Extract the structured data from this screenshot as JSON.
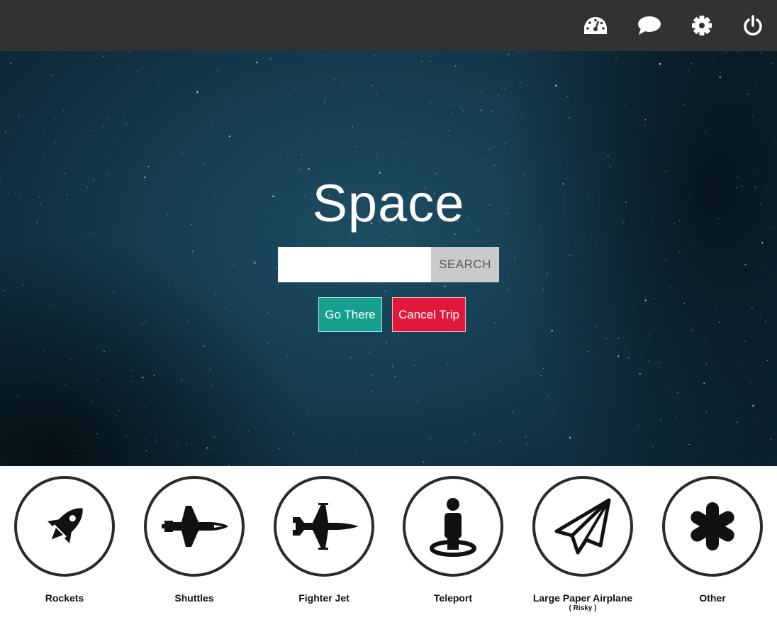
{
  "topbar": {
    "icons": [
      "dashboard-icon",
      "chat-bubble-icon",
      "gear-icon",
      "power-icon"
    ]
  },
  "hero": {
    "title": "Space",
    "search": {
      "value": "",
      "placeholder": "",
      "button_label": "SEARCH"
    },
    "go_label": "Go There",
    "cancel_label": "Cancel Trip"
  },
  "modes": [
    {
      "label": "Rockets",
      "icon": "rocket-icon"
    },
    {
      "label": "Shuttles",
      "icon": "space-shuttle-icon"
    },
    {
      "label": "Fighter Jet",
      "icon": "fighter-jet-icon"
    },
    {
      "label": "Teleport",
      "icon": "teleport-icon"
    },
    {
      "label": "Large Paper Airplane",
      "sublabel": "( Risky )",
      "icon": "paper-airplane-icon"
    },
    {
      "label": "Other",
      "icon": "asterisk-icon"
    }
  ],
  "colors": {
    "topbar": "#323232",
    "go_button": "#16a08e",
    "cancel_button": "#e0193a",
    "search_button": "#cacaca"
  }
}
